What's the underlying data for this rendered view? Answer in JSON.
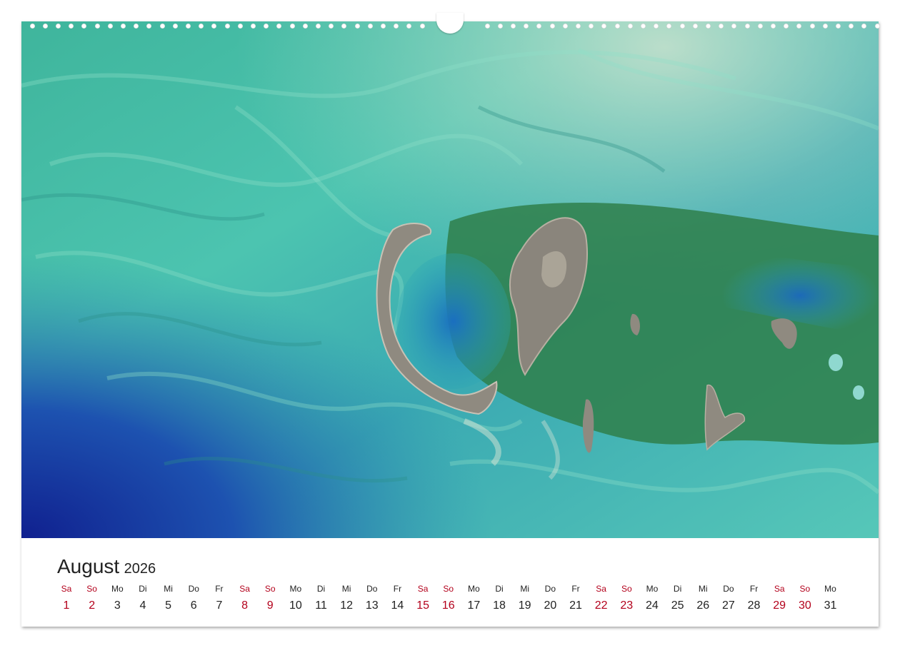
{
  "calendar": {
    "month": "August",
    "year": "2026",
    "weekday_labels": [
      "Sa",
      "So",
      "Mo",
      "Di",
      "Mi",
      "Do",
      "Fr",
      "Sa",
      "So",
      "Mo",
      "Di",
      "Mi",
      "Do",
      "Fr",
      "Sa",
      "So",
      "Mo",
      "Di",
      "Mi",
      "Do",
      "Fr",
      "Sa",
      "So",
      "Mo",
      "Di",
      "Mi",
      "Do",
      "Fr",
      "Sa",
      "So",
      "Mo"
    ],
    "day_numbers": [
      "1",
      "2",
      "3",
      "4",
      "5",
      "6",
      "7",
      "8",
      "9",
      "10",
      "11",
      "12",
      "13",
      "14",
      "15",
      "16",
      "17",
      "18",
      "19",
      "20",
      "21",
      "22",
      "23",
      "24",
      "25",
      "26",
      "27",
      "28",
      "29",
      "30",
      "31"
    ],
    "weekend_days": [
      "Sa",
      "So"
    ]
  },
  "photo": {
    "subject": "satellite-image-islands-turquoise-sea"
  },
  "colors": {
    "weekend": "#b3001b",
    "text": "#222222",
    "sea_light": "#4fc7b0",
    "sea_deep": "#1a3fa8",
    "island": "#8f8a80",
    "vegetation": "#2f7f4a"
  }
}
